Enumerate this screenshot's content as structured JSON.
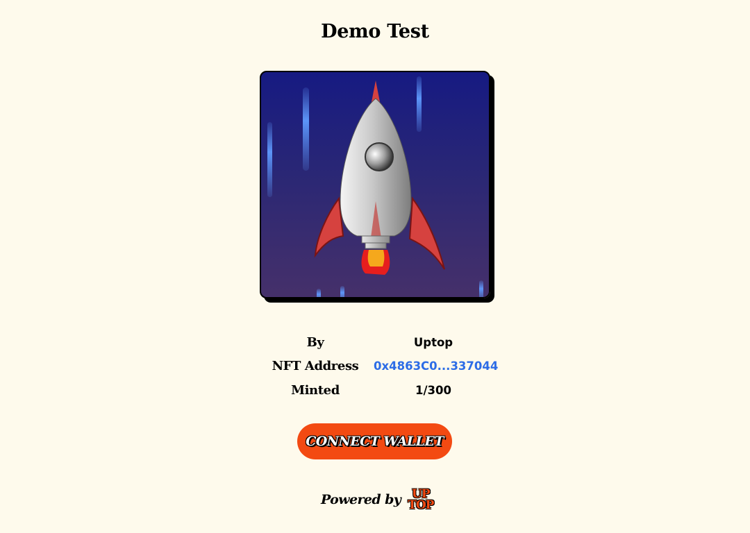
{
  "page": {
    "title": "Demo Test"
  },
  "art": {
    "subject": "rocket-illustration",
    "colors": {
      "sky_top": "#161a82",
      "sky_bottom": "#45306a",
      "streak": "#5f9bff",
      "fin": "#d6423f",
      "flame_outer": "#e61e1e",
      "flame_inner": "#f5a81c"
    }
  },
  "info": {
    "rows": [
      {
        "label": "By",
        "value": "Uptop",
        "is_link": false
      },
      {
        "label": "NFT Address",
        "value": "0x4863C0...337044",
        "is_link": true
      },
      {
        "label": "Minted",
        "value": "1/300",
        "is_link": false
      }
    ]
  },
  "actions": {
    "connect_label": "CONNECT WALLET"
  },
  "footer": {
    "powered_label": "Powered by",
    "logo_line1": "UP",
    "logo_line2": "TOP"
  },
  "colors": {
    "background": "#fefaec",
    "accent": "#f34a12",
    "link": "#2c6ce6"
  }
}
